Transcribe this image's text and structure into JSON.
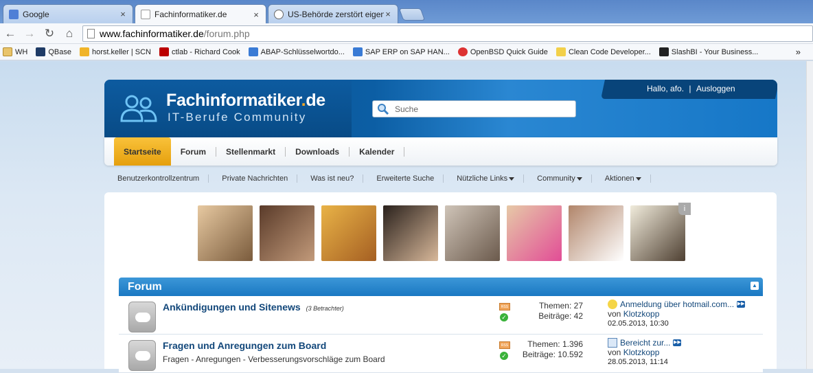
{
  "browser": {
    "tabs": [
      {
        "title": "Google",
        "active": false
      },
      {
        "title": "Fachinformatiker.de",
        "active": true
      },
      {
        "title": "US-Behörde zerstört eigene",
        "active": false
      }
    ],
    "url_host": "www.fachinformatiker.de",
    "url_path": "/forum.php",
    "bookmarks": [
      "WH",
      "QBase",
      "horst.keller | SCN",
      "ctlab - Richard Cook",
      "ABAP-Schlüsselwortdo...",
      "SAP ERP on SAP HAN...",
      "OpenBSD Quick Guide",
      "Clean Code Developer...",
      "SlashBI - Your Business..."
    ],
    "bookmarks_more": "»"
  },
  "site": {
    "logo_name": "Fachinformatiker",
    "logo_dot": ".",
    "logo_tld": "de",
    "logo_sub": "IT-Berufe Community",
    "search_placeholder": "Suche",
    "greeting": "Hallo, afo.",
    "separator": "|",
    "logout": "Ausloggen"
  },
  "nav": {
    "tabs": [
      "Startseite",
      "Forum",
      "Stellenmarkt",
      "Downloads",
      "Kalender"
    ],
    "active": "Startseite"
  },
  "subnav": [
    {
      "label": "Benutzerkontrollzentrum",
      "dropdown": false
    },
    {
      "label": "Private Nachrichten",
      "dropdown": false
    },
    {
      "label": "Was ist neu?",
      "dropdown": false
    },
    {
      "label": "Erweiterte Suche",
      "dropdown": false
    },
    {
      "label": "Nützliche Links",
      "dropdown": true
    },
    {
      "label": "Community",
      "dropdown": true
    },
    {
      "label": "Aktionen",
      "dropdown": true
    }
  ],
  "ad_info": "i",
  "forum": {
    "title": "Forum",
    "rows": [
      {
        "name": "Ankündigungen und Sitenews",
        "viewers": "(3 Betrachter)",
        "description": "",
        "topics": "Themen: 27",
        "posts": "Beiträge: 42",
        "last_title": "Anmeldung über hotmail.com...",
        "last_by_prefix": "von",
        "last_user": "Klotzkopp",
        "last_date": "02.05.2013, 10:30"
      },
      {
        "name": "Fragen und Anregungen zum Board",
        "viewers": "",
        "description": "Fragen - Anregungen - Verbesserungsvorschläge zum Board",
        "topics": "Themen: 1.396",
        "posts": "Beiträge: 10.592",
        "last_title": "Bereicht zur...",
        "last_by_prefix": "von",
        "last_user": "Klotzkopp",
        "last_date": "28.05.2013, 11:14"
      }
    ]
  },
  "colors": {
    "header_dark": "#0b4f8c",
    "active_tab": "#e59f0d",
    "forum_bar": "#1a78c2",
    "link": "#12477a"
  }
}
